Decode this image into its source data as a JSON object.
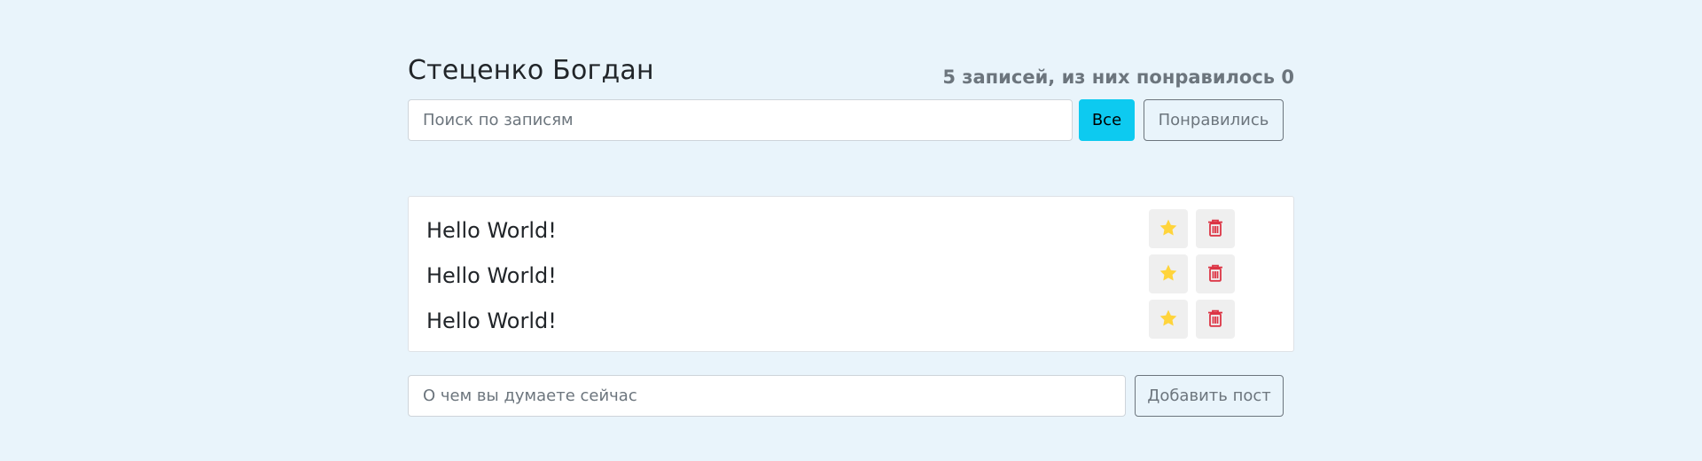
{
  "header": {
    "title": "Стеценко Богдан",
    "counter": "5 записей, из них понравилось 0"
  },
  "search": {
    "placeholder": "Поиск по записям",
    "value": ""
  },
  "filters": {
    "all_label": "Все",
    "liked_label": "Понравились",
    "active": "all"
  },
  "posts": [
    {
      "text": "Hello World!",
      "liked": false
    },
    {
      "text": "Hello World!",
      "liked": false
    },
    {
      "text": "Hello World!",
      "liked": false
    }
  ],
  "post_actions": {
    "star_icon": "star-icon",
    "trash_icon": "trash-icon"
  },
  "add_post": {
    "placeholder": "О чем вы думаете сейчас",
    "value": "",
    "button_label": "Добавить пост"
  },
  "colors": {
    "background": "#e9f4fb",
    "accent": "#0dcaf0",
    "star": "#ffd43b",
    "trash": "#dc3545",
    "muted": "#6c757d"
  }
}
